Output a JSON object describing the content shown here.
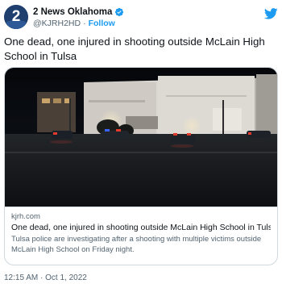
{
  "account": {
    "display_name": "2 News Oklahoma",
    "handle": "@KJRH2HD",
    "follow_label": "Follow",
    "separator": "·",
    "avatar_text": "2",
    "verified_icon": "verified-badge-icon"
  },
  "tweet": {
    "text": "One dead, one injured in shooting outside McLain High School in Tulsa",
    "timestamp": "12:15 AM · Oct 1, 2022"
  },
  "link_card": {
    "domain": "kjrh.com",
    "title": "One dead, one injured in shooting outside McLain High School in Tulsa",
    "description": "Tulsa police are investigating after a shooting with multiple victims outside McLain High School on Friday night."
  },
  "colors": {
    "accent": "#1d9bf0",
    "text": "#0f1419",
    "secondary": "#536471",
    "border": "#cfd9de",
    "avatar": "#1f3f6e"
  }
}
